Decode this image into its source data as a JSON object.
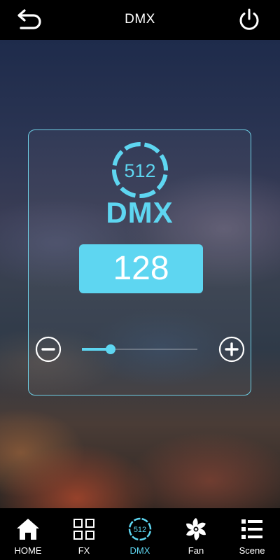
{
  "header": {
    "title": "DMX",
    "back_icon": "back-arrow-icon",
    "power_icon": "power-icon"
  },
  "panel": {
    "mode_icon_text": "512",
    "mode_title": "DMX",
    "value": "128",
    "slider_fraction": 0.25,
    "minus_icon": "minus-circle-icon",
    "plus_icon": "plus-circle-icon"
  },
  "nav": {
    "items": [
      {
        "label": "HOME",
        "icon": "home-icon"
      },
      {
        "label": "FX",
        "icon": "grid-icon"
      },
      {
        "label": "DMX",
        "icon": "dmx-512-icon",
        "icon_text": "512",
        "active": true
      },
      {
        "label": "Fan",
        "icon": "fan-icon"
      },
      {
        "label": "Scene",
        "icon": "list-icon"
      }
    ]
  },
  "colors": {
    "accent": "#5ed6f1",
    "bar_background": "#000000",
    "panel_border": "#6fd0e6"
  }
}
